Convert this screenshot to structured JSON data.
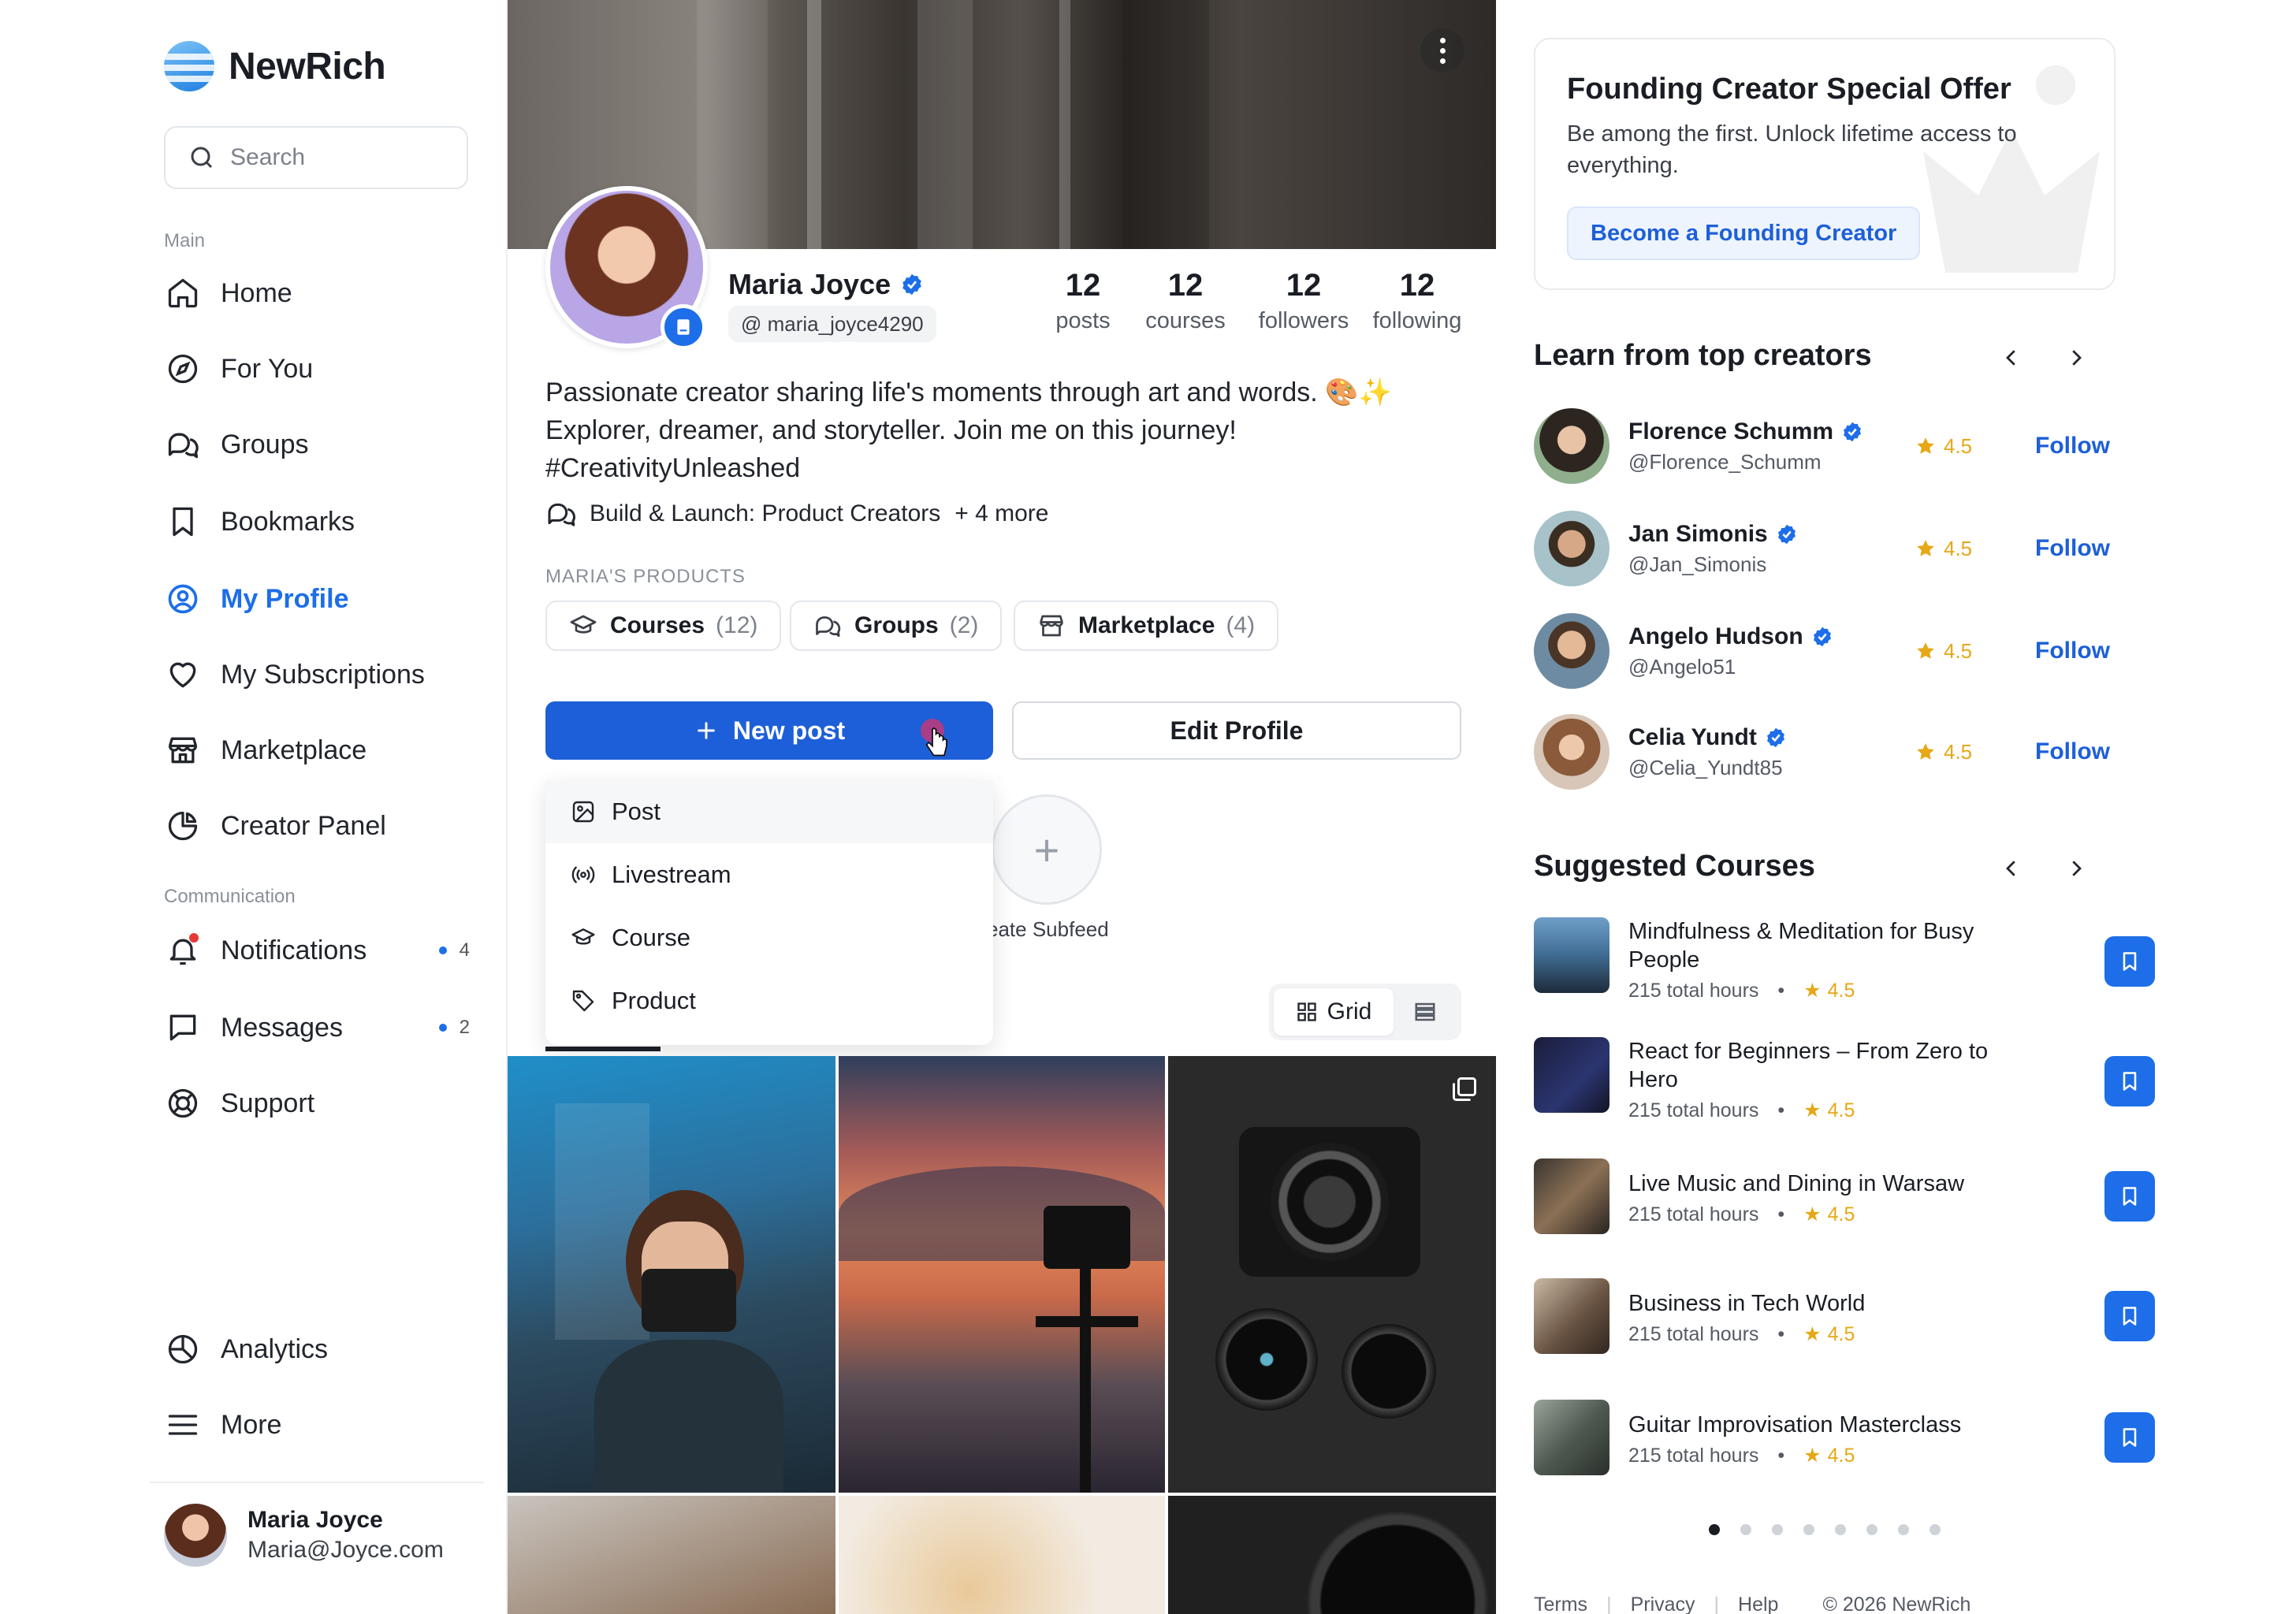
{
  "brand": {
    "name": "NewRich"
  },
  "search": {
    "placeholder": "Search"
  },
  "sidebar": {
    "section_main": "Main",
    "items": [
      {
        "label": "Home"
      },
      {
        "label": "For You"
      },
      {
        "label": "Groups"
      },
      {
        "label": "Bookmarks"
      },
      {
        "label": "My Profile"
      },
      {
        "label": "My Subscriptions"
      },
      {
        "label": "Marketplace"
      },
      {
        "label": "Creator Panel"
      }
    ],
    "section_comm": "Communication",
    "comm_items": [
      {
        "label": "Notifications",
        "count": "4"
      },
      {
        "label": "Messages",
        "count": "2"
      },
      {
        "label": "Support"
      }
    ],
    "bottom_items": [
      {
        "label": "Analytics"
      },
      {
        "label": "More"
      }
    ],
    "user": {
      "name": "Maria Joyce",
      "email": "Maria@Joyce.com"
    }
  },
  "profile": {
    "name": "Maria Joyce",
    "handle": "@ maria_joyce4290",
    "stats": [
      {
        "value": "12",
        "label": "posts"
      },
      {
        "value": "12",
        "label": "courses"
      },
      {
        "value": "12",
        "label": "followers"
      },
      {
        "value": "12",
        "label": "following"
      }
    ],
    "bio_line1": "Passionate creator sharing life's moments through art and words. 🎨✨",
    "bio_line2": "Explorer, dreamer, and storyteller. Join me on this journey!",
    "bio_line3": "#CreativityUnleashed",
    "group": "Build & Launch: Product Creators",
    "group_more": "+ 4 more",
    "products_label": "MARIA'S PRODUCTS",
    "products": [
      {
        "label": "Courses",
        "count": "(12)"
      },
      {
        "label": "Groups",
        "count": "(2)"
      },
      {
        "label": "Marketplace",
        "count": "(4)"
      }
    ],
    "new_post": "New post",
    "edit_profile": "Edit Profile",
    "menu": [
      {
        "label": "Post"
      },
      {
        "label": "Livestream"
      },
      {
        "label": "Course"
      },
      {
        "label": "Product"
      }
    ],
    "subfeed_label": "eate Subfeed",
    "view_grid": "Grid"
  },
  "offer": {
    "title": "Founding Creator Special Offer",
    "text": "Be among the first. Unlock lifetime access to everything.",
    "cta": "Become a Founding Creator"
  },
  "creators": {
    "title": "Learn from top creators",
    "follow_label": "Follow",
    "items": [
      {
        "name": "Florence Schumm",
        "handle": "@Florence_Schumm",
        "rating": "4.5"
      },
      {
        "name": "Jan Simonis",
        "handle": "@Jan_Simonis",
        "rating": "4.5"
      },
      {
        "name": "Angelo Hudson",
        "handle": "@Angelo51",
        "rating": "4.5"
      },
      {
        "name": "Celia Yundt",
        "handle": "@Celia_Yundt85",
        "rating": "4.5"
      }
    ]
  },
  "courses": {
    "title": "Suggested Courses",
    "items": [
      {
        "title": "Mindfulness & Meditation for Busy People",
        "hours": "215 total hours",
        "rating": "4.5"
      },
      {
        "title": "React for Beginners – From Zero to Hero",
        "hours": "215 total hours",
        "rating": "4.5"
      },
      {
        "title": "Live Music and Dining in Warsaw",
        "hours": "215 total hours",
        "rating": "4.5"
      },
      {
        "title": "Business in Tech World",
        "hours": "215 total hours",
        "rating": "4.5"
      },
      {
        "title": "Guitar Improvisation Masterclass",
        "hours": "215 total hours",
        "rating": "4.5"
      }
    ]
  },
  "footer": {
    "terms": "Terms",
    "privacy": "Privacy",
    "help": "Help",
    "copyright": "© 2026 NewRich"
  },
  "colors": {
    "accent": "#1d6ee8",
    "primary_button": "#1d5fd8",
    "star": "#e6a817"
  }
}
